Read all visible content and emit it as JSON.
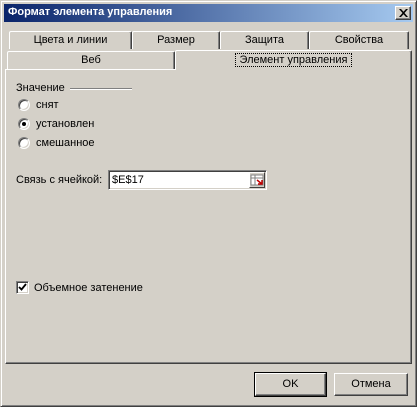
{
  "dialog": {
    "title": "Формат элемента управления",
    "close_symbol": "×"
  },
  "tabs": {
    "row_back": [
      "Цвета и линии",
      "Размер",
      "Защита",
      "Свойства"
    ],
    "row_front": [
      "Веб",
      "Элемент управления"
    ],
    "active": "Элемент управления"
  },
  "value_group": {
    "label": "Значение",
    "options": [
      {
        "label": "снят",
        "selected": false
      },
      {
        "label": "установлен",
        "selected": true
      },
      {
        "label": "смешанное",
        "selected": false
      }
    ]
  },
  "cell_link": {
    "label": "Связь с ячейкой:",
    "value": "$E$17",
    "button_icon": "range-select-icon"
  },
  "shading": {
    "label": "Объемное затенение",
    "checked": true
  },
  "buttons": {
    "ok": "OK",
    "cancel": "Отмена"
  }
}
